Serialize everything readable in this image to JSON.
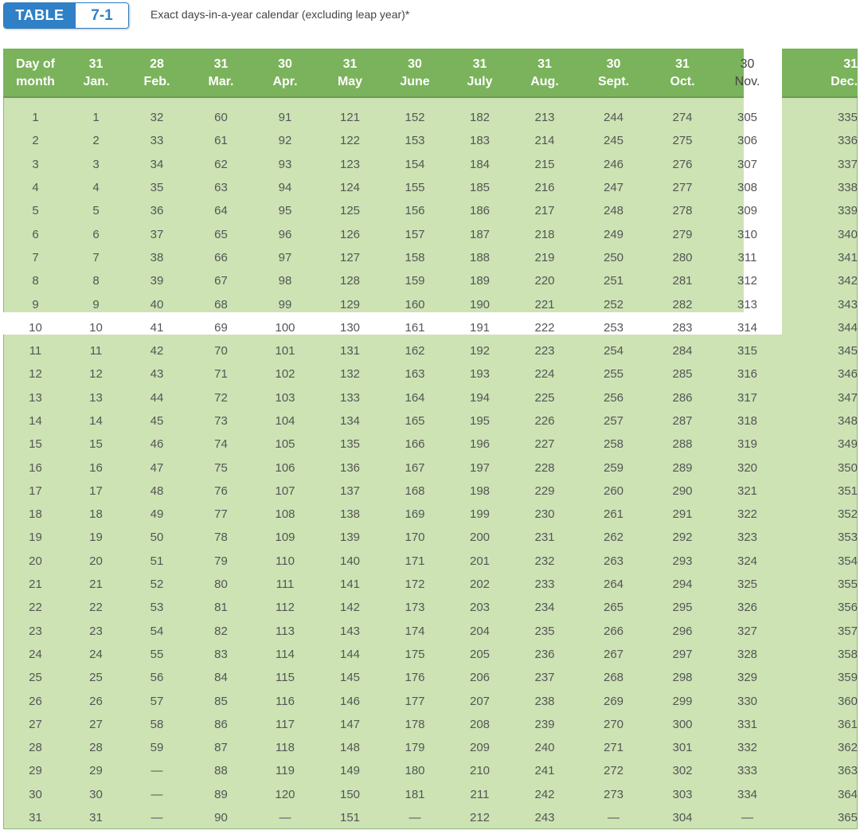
{
  "header": {
    "badge_label": "TABLE",
    "badge_number": "7-1",
    "caption": "Exact days-in-a-year calendar (excluding leap year)*"
  },
  "table": {
    "first_header": [
      "Day of",
      "month"
    ],
    "months": [
      {
        "days": "31",
        "name": "Jan."
      },
      {
        "days": "28",
        "name": "Feb."
      },
      {
        "days": "31",
        "name": "Mar."
      },
      {
        "days": "30",
        "name": "Apr."
      },
      {
        "days": "31",
        "name": "May"
      },
      {
        "days": "30",
        "name": "June"
      },
      {
        "days": "31",
        "name": "July"
      },
      {
        "days": "31",
        "name": "Aug."
      },
      {
        "days": "30",
        "name": "Sept."
      },
      {
        "days": "31",
        "name": "Oct."
      },
      {
        "days": "30",
        "name": "Nov."
      },
      {
        "days": "31",
        "name": "Dec."
      }
    ],
    "rows": [
      [
        "1",
        "1",
        "32",
        "60",
        "91",
        "121",
        "152",
        "182",
        "213",
        "244",
        "274",
        "305",
        "335"
      ],
      [
        "2",
        "2",
        "33",
        "61",
        "92",
        "122",
        "153",
        "183",
        "214",
        "245",
        "275",
        "306",
        "336"
      ],
      [
        "3",
        "3",
        "34",
        "62",
        "93",
        "123",
        "154",
        "184",
        "215",
        "246",
        "276",
        "307",
        "337"
      ],
      [
        "4",
        "4",
        "35",
        "63",
        "94",
        "124",
        "155",
        "185",
        "216",
        "247",
        "277",
        "308",
        "338"
      ],
      [
        "5",
        "5",
        "36",
        "64",
        "95",
        "125",
        "156",
        "186",
        "217",
        "248",
        "278",
        "309",
        "339"
      ],
      [
        "6",
        "6",
        "37",
        "65",
        "96",
        "126",
        "157",
        "187",
        "218",
        "249",
        "279",
        "310",
        "340"
      ],
      [
        "7",
        "7",
        "38",
        "66",
        "97",
        "127",
        "158",
        "188",
        "219",
        "250",
        "280",
        "311",
        "341"
      ],
      [
        "8",
        "8",
        "39",
        "67",
        "98",
        "128",
        "159",
        "189",
        "220",
        "251",
        "281",
        "312",
        "342"
      ],
      [
        "9",
        "9",
        "40",
        "68",
        "99",
        "129",
        "160",
        "190",
        "221",
        "252",
        "282",
        "313",
        "343"
      ],
      [
        "10",
        "10",
        "41",
        "69",
        "100",
        "130",
        "161",
        "191",
        "222",
        "253",
        "283",
        "314",
        "344"
      ],
      [
        "11",
        "11",
        "42",
        "70",
        "101",
        "131",
        "162",
        "192",
        "223",
        "254",
        "284",
        "315",
        "345"
      ],
      [
        "12",
        "12",
        "43",
        "71",
        "102",
        "132",
        "163",
        "193",
        "224",
        "255",
        "285",
        "316",
        "346"
      ],
      [
        "13",
        "13",
        "44",
        "72",
        "103",
        "133",
        "164",
        "194",
        "225",
        "256",
        "286",
        "317",
        "347"
      ],
      [
        "14",
        "14",
        "45",
        "73",
        "104",
        "134",
        "165",
        "195",
        "226",
        "257",
        "287",
        "318",
        "348"
      ],
      [
        "15",
        "15",
        "46",
        "74",
        "105",
        "135",
        "166",
        "196",
        "227",
        "258",
        "288",
        "319",
        "349"
      ],
      [
        "16",
        "16",
        "47",
        "75",
        "106",
        "136",
        "167",
        "197",
        "228",
        "259",
        "289",
        "320",
        "350"
      ],
      [
        "17",
        "17",
        "48",
        "76",
        "107",
        "137",
        "168",
        "198",
        "229",
        "260",
        "290",
        "321",
        "351"
      ],
      [
        "18",
        "18",
        "49",
        "77",
        "108",
        "138",
        "169",
        "199",
        "230",
        "261",
        "291",
        "322",
        "352"
      ],
      [
        "19",
        "19",
        "50",
        "78",
        "109",
        "139",
        "170",
        "200",
        "231",
        "262",
        "292",
        "323",
        "353"
      ],
      [
        "20",
        "20",
        "51",
        "79",
        "110",
        "140",
        "171",
        "201",
        "232",
        "263",
        "293",
        "324",
        "354"
      ],
      [
        "21",
        "21",
        "52",
        "80",
        "111",
        "141",
        "172",
        "202",
        "233",
        "264",
        "294",
        "325",
        "355"
      ],
      [
        "22",
        "22",
        "53",
        "81",
        "112",
        "142",
        "173",
        "203",
        "234",
        "265",
        "295",
        "326",
        "356"
      ],
      [
        "23",
        "23",
        "54",
        "82",
        "113",
        "143",
        "174",
        "204",
        "235",
        "266",
        "296",
        "327",
        "357"
      ],
      [
        "24",
        "24",
        "55",
        "83",
        "114",
        "144",
        "175",
        "205",
        "236",
        "267",
        "297",
        "328",
        "358"
      ],
      [
        "25",
        "25",
        "56",
        "84",
        "115",
        "145",
        "176",
        "206",
        "237",
        "268",
        "298",
        "329",
        "359"
      ],
      [
        "26",
        "26",
        "57",
        "85",
        "116",
        "146",
        "177",
        "207",
        "238",
        "269",
        "299",
        "330",
        "360"
      ],
      [
        "27",
        "27",
        "58",
        "86",
        "117",
        "147",
        "178",
        "208",
        "239",
        "270",
        "300",
        "331",
        "361"
      ],
      [
        "28",
        "28",
        "59",
        "87",
        "118",
        "148",
        "179",
        "209",
        "240",
        "271",
        "301",
        "332",
        "362"
      ],
      [
        "29",
        "29",
        "—",
        "88",
        "119",
        "149",
        "180",
        "210",
        "241",
        "272",
        "302",
        "333",
        "363"
      ],
      [
        "30",
        "30",
        "—",
        "89",
        "120",
        "150",
        "181",
        "211",
        "242",
        "273",
        "303",
        "334",
        "364"
      ],
      [
        "31",
        "31",
        "—",
        "90",
        "—",
        "151",
        "—",
        "212",
        "243",
        "—",
        "304",
        "—",
        "365"
      ]
    ]
  },
  "colors": {
    "header_green": "#7ab35b",
    "body_green": "#cde3b4",
    "badge_blue": "#2f80c6",
    "highlight": "#ffffff"
  }
}
